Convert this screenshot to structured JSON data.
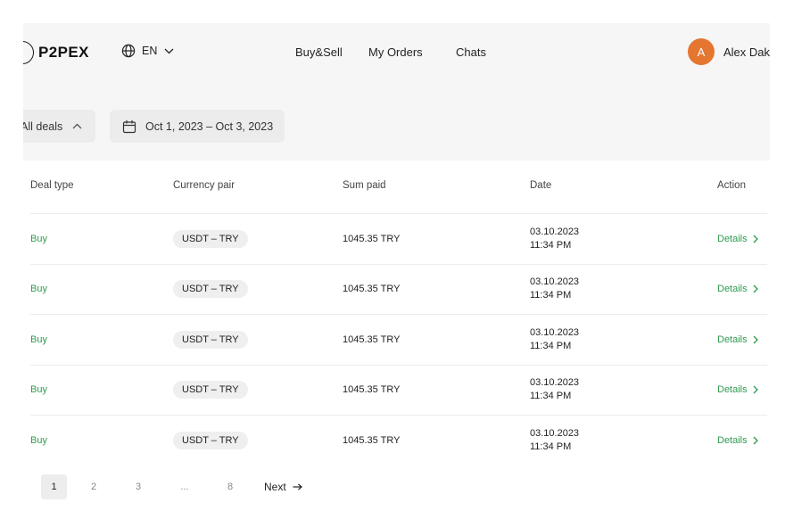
{
  "brand": {
    "name": "P2PEX"
  },
  "language": {
    "code": "EN"
  },
  "nav": {
    "buy_sell": "Buy&Sell",
    "my_orders": "My Orders",
    "chats": "Chats"
  },
  "user": {
    "initial": "A",
    "name": "Alex Dak",
    "avatar_color": "#e4762f"
  },
  "filters": {
    "deals_label": "All deals",
    "date_range": "Oct 1, 2023 – Oct 3, 2023"
  },
  "table": {
    "columns": [
      "Deal type",
      "Currency pair",
      "Sum paid",
      "Date",
      "Action"
    ],
    "rows": [
      {
        "type": "Buy",
        "pair": "USDT – TRY",
        "sum": "1045.35 TRY",
        "date": "03.10.2023",
        "time": "11:34 PM",
        "action": "Details"
      },
      {
        "type": "Buy",
        "pair": "USDT – TRY",
        "sum": "1045.35 TRY",
        "date": "03.10.2023",
        "time": "11:34 PM",
        "action": "Details"
      },
      {
        "type": "Buy",
        "pair": "USDT – TRY",
        "sum": "1045.35 TRY",
        "date": "03.10.2023",
        "time": "11:34 PM",
        "action": "Details"
      },
      {
        "type": "Buy",
        "pair": "USDT – TRY",
        "sum": "1045.35 TRY",
        "date": "03.10.2023",
        "time": "11:34 PM",
        "action": "Details"
      },
      {
        "type": "Buy",
        "pair": "USDT – TRY",
        "sum": "1045.35 TRY",
        "date": "03.10.2023",
        "time": "11:34 PM",
        "action": "Details"
      }
    ]
  },
  "pagination": {
    "pages": [
      "1",
      "2",
      "3",
      "...",
      "8"
    ],
    "current": "1",
    "next_label": "Next"
  },
  "colors": {
    "accent_green": "#2e9a4f",
    "avatar": "#e4762f",
    "surface": "#f6f6f6"
  }
}
